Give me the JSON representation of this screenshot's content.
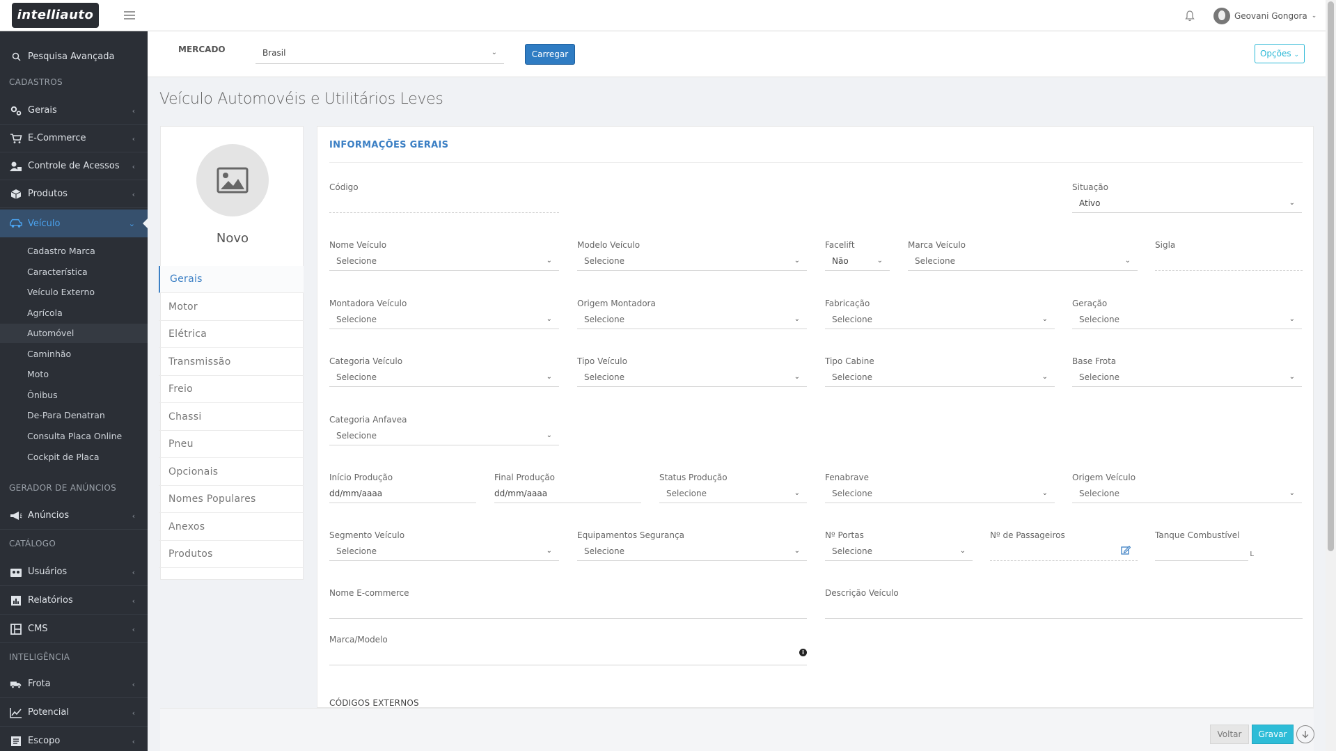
{
  "app": {
    "logo": "intelliauto"
  },
  "topbar": {
    "user_name": "Geovani Gongora"
  },
  "sidebar": {
    "search": "Pesquisa Avançada",
    "section_cadastros": "CADASTROS",
    "gerais": "Gerais",
    "ecommerce": "E-Commerce",
    "controle": "Controle de Acessos",
    "produtos": "Produtos",
    "veiculo": "Veículo",
    "sub": {
      "cadastro_marca": "Cadastro Marca",
      "caracteristica": "Característica",
      "veiculo_externo": "Veículo Externo",
      "agricola": "Agrícola",
      "automovel": "Automóvel",
      "caminhao": "Caminhão",
      "moto": "Moto",
      "onibus": "Ônibus",
      "de_para": "De-Para Denatran",
      "consulta_placa": "Consulta Placa Online",
      "cockpit": "Cockpit de Placa"
    },
    "section_gerador": "GERADOR DE ANÚNCIOS",
    "anuncios": "Anúncios",
    "section_catalogo": "CATÁLOGO",
    "usuarios": "Usuários",
    "relatorios": "Relatórios",
    "cms": "CMS",
    "section_inteligencia": "INTELIGÊNCIA",
    "frota": "Frota",
    "potencial": "Potencial",
    "escopo": "Escopo"
  },
  "market": {
    "label": "MERCADO",
    "value": "Brasil",
    "load_button": "Carregar",
    "options_button": "Opções"
  },
  "page": {
    "title": "Veículo Automovéis e Utilitários Leves"
  },
  "left_panel": {
    "name": "Novo",
    "tabs": [
      "Gerais",
      "Motor",
      "Elétrica",
      "Transmissão",
      "Freio",
      "Chassi",
      "Pneu",
      "Opcionais",
      "Nomes Populares",
      "Anexos",
      "Produtos"
    ]
  },
  "form": {
    "section_title": "INFORMAÇÕES GERAIS",
    "select_placeholder": "Selecione",
    "date_placeholder": "dd/mm/aaaa",
    "codigo": {
      "label": "Código"
    },
    "situacao": {
      "label": "Situação",
      "value": "Ativo"
    },
    "nome_veiculo": {
      "label": "Nome Veículo"
    },
    "modelo_veiculo": {
      "label": "Modelo Veículo"
    },
    "facelift": {
      "label": "Facelift",
      "value": "Não"
    },
    "marca_veiculo": {
      "label": "Marca Veículo"
    },
    "sigla": {
      "label": "Sigla"
    },
    "montadora": {
      "label": "Montadora Veículo"
    },
    "origem_montadora": {
      "label": "Origem Montadora"
    },
    "fabricacao": {
      "label": "Fabricação"
    },
    "geracao": {
      "label": "Geração"
    },
    "categoria_veiculo": {
      "label": "Categoria Veículo"
    },
    "tipo_veiculo": {
      "label": "Tipo Veículo"
    },
    "tipo_cabine": {
      "label": "Tipo Cabine"
    },
    "base_frota": {
      "label": "Base Frota"
    },
    "categoria_anfavea": {
      "label": "Categoria Anfavea"
    },
    "inicio_producao": {
      "label": "Início Produção"
    },
    "final_producao": {
      "label": "Final Produção"
    },
    "status_producao": {
      "label": "Status Produção"
    },
    "fenabrave": {
      "label": "Fenabrave"
    },
    "origem_veiculo": {
      "label": "Origem Veículo"
    },
    "segmento": {
      "label": "Segmento Veículo"
    },
    "equipamentos": {
      "label": "Equipamentos Segurança"
    },
    "portas": {
      "label": "Nº Portas"
    },
    "passageiros": {
      "label": "Nº de Passageiros"
    },
    "tanque": {
      "label": "Tanque Combustível",
      "unit": "L"
    },
    "nome_ecommerce": {
      "label": "Nome E-commerce"
    },
    "descricao": {
      "label": "Descrição Veículo"
    },
    "marca_modelo": {
      "label": "Marca/Modelo"
    },
    "codigos_externos": "CÓDIGOS EXTERNOS"
  },
  "footer": {
    "back_button": "Voltar",
    "save_button": "Gravar"
  }
}
